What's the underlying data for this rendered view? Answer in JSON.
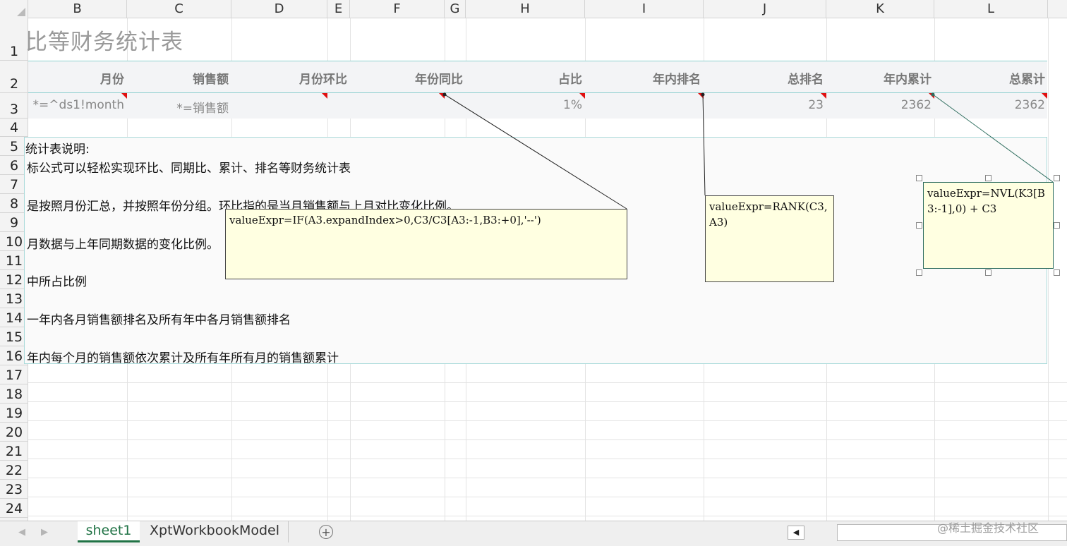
{
  "columns": [
    "B",
    "C",
    "D",
    "E",
    "F",
    "G",
    "H",
    "I",
    "J",
    "K",
    "L"
  ],
  "rows": [
    "1",
    "2",
    "3",
    "4",
    "5",
    "6",
    "7",
    "8",
    "9",
    "10",
    "11",
    "12",
    "13",
    "14",
    "15",
    "16",
    "17",
    "18",
    "19",
    "20",
    "21",
    "22",
    "23",
    "24"
  ],
  "title": "比等财务统计表",
  "headers": [
    "月份",
    "销售额",
    "月份环比",
    "年份同比",
    "占比",
    "年内排名",
    "总排名",
    "年内累计",
    "总累计"
  ],
  "row3": {
    "month": "*=^ds1!month",
    "sales": "*=销售额",
    "ratio": "1%",
    "rank_total": "23",
    "cum_year": "2362",
    "cum_total": "2362"
  },
  "notes": [
    "统计表说明:",
    "标公式可以轻松实现环比、同期比、累计、排名等财务统计表",
    "是按照月份汇总，并按照年份分组。环比指的是当月销售额与上月对比变化比例。",
    "月数据与上年同期数据的变化比例。",
    "中所占比例",
    "一年内各月销售额排名及所有年中各月销售额排名",
    "年内每个月的销售额依次累计及所有年所有月的销售额累计"
  ],
  "comments": {
    "yoy": "valueExpr=IF(A3.expandIndex>0,C3/C3[A3:-1,B3:+0],'--')",
    "rank": "valueExpr=RANK(C3,A3)",
    "cum": "valueExpr=NVL(K3[B3:-1],0) + C3"
  },
  "sheets": {
    "active": "sheet1",
    "other": "XptWorkbookModel"
  },
  "watermark": "@稀土掘金技术社区",
  "colors": {
    "tab_accent": "#217346",
    "comment_bg": "#ffffe1",
    "marker": "#e01010",
    "band_border": "#8fd0cf"
  },
  "icons": [
    "add-sheet-icon",
    "scroll-left-icon",
    "sheet-nav-prev-icon",
    "sheet-nav-next-icon",
    "comment-marker-icon"
  ]
}
